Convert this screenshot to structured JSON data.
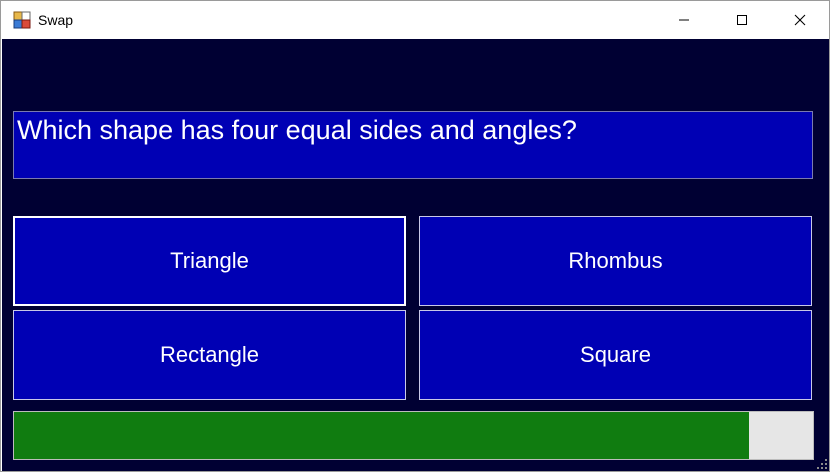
{
  "window": {
    "title": "Swap"
  },
  "quiz": {
    "question": "Which shape has four equal sides and angles?",
    "answers": [
      "Triangle",
      "Rhombus",
      "Rectangle",
      "Square"
    ],
    "selected_index": 0
  },
  "timer": {
    "progress_fraction": 0.92
  },
  "icons": {
    "app": "app-icon",
    "minimize": "minimize-icon",
    "maximize": "maximize-icon",
    "close": "close-icon",
    "grip": "resize-grip-icon"
  },
  "colors": {
    "background": "#000033",
    "panel": "#0000b4",
    "progress": "#107c10"
  }
}
